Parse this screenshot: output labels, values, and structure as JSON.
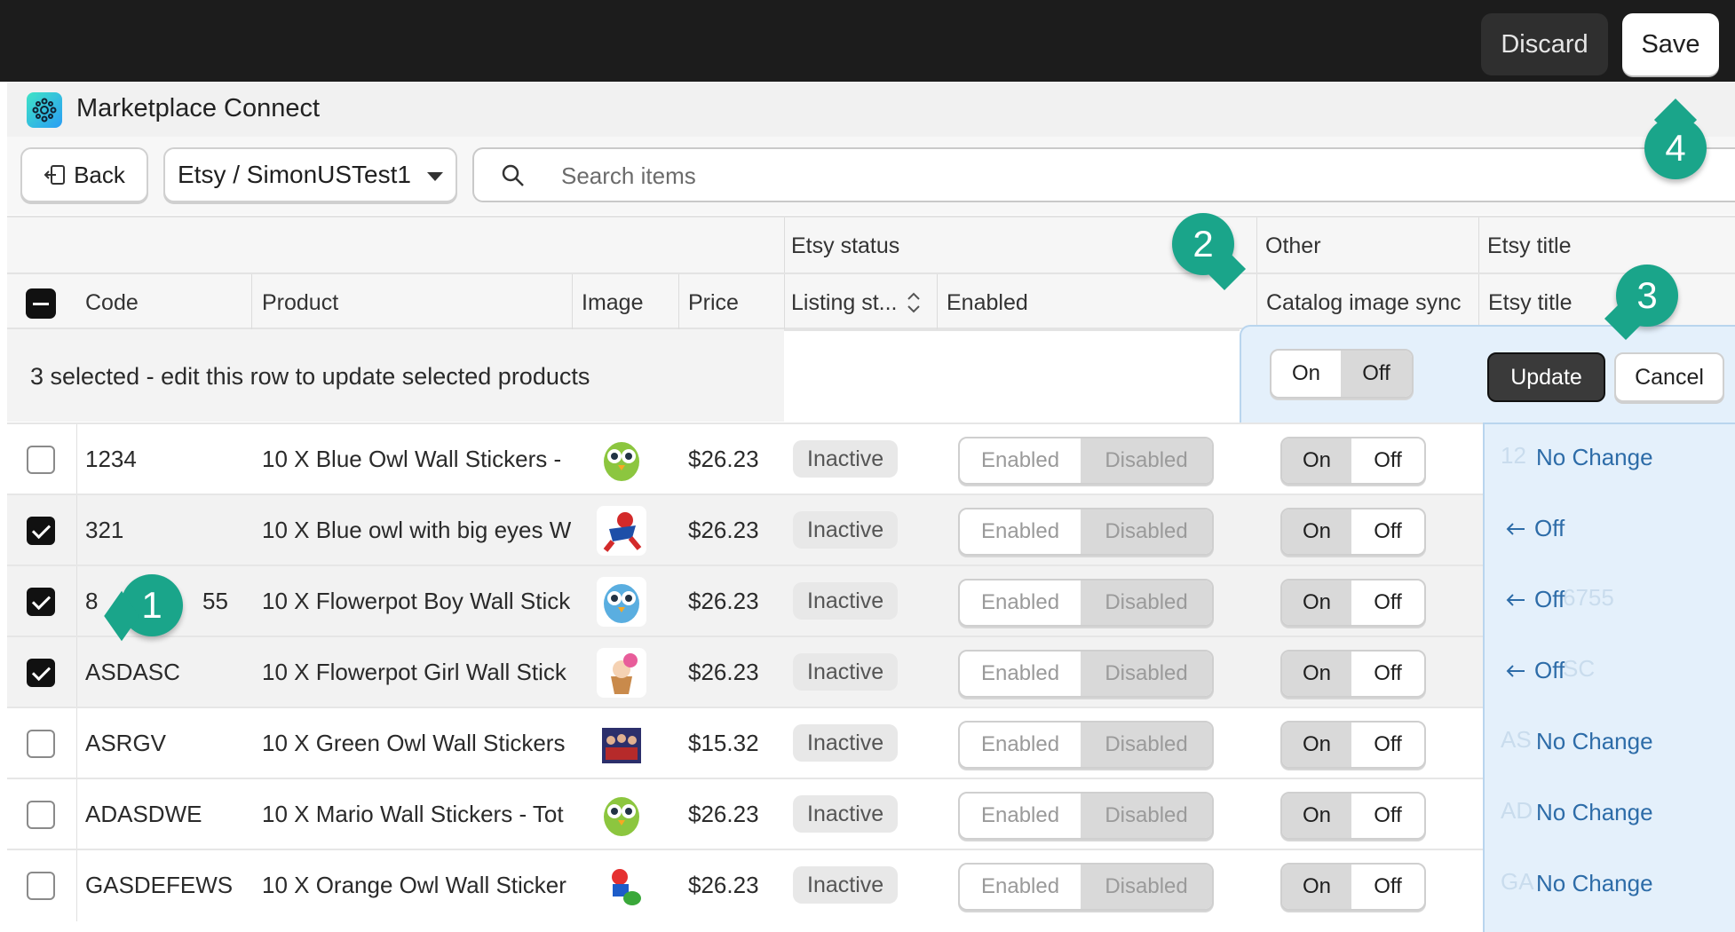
{
  "top_bar": {
    "discard_label": "Discard",
    "save_label": "Save"
  },
  "app": {
    "title": "Marketplace Connect"
  },
  "toolbar": {
    "back_label": "Back",
    "store_selector": "Etsy / SimonUSTest1",
    "search_placeholder": "Search items"
  },
  "table": {
    "groups": {
      "etsy_status": "Etsy status",
      "other": "Other",
      "etsy_title": "Etsy title"
    },
    "columns": {
      "code": "Code",
      "product": "Product",
      "image": "Image",
      "price": "Price",
      "listing_status": "Listing st...",
      "enabled": "Enabled",
      "catalog_image_sync": "Catalog image sync",
      "etsy_title": "Etsy title"
    },
    "bulk_row": {
      "message": "3 selected - edit this row to update selected products",
      "sync_on": "On",
      "sync_off": "Off",
      "sync_selected": "Off",
      "update_label": "Update",
      "cancel_label": "Cancel"
    },
    "toggle_labels": {
      "enabled": "Enabled",
      "disabled": "Disabled",
      "on": "On",
      "off": "Off"
    },
    "rows": [
      {
        "checked": false,
        "code": "1234",
        "product": "10 X Blue Owl Wall Stickers -",
        "image": "green-owl-thumbnail",
        "price": "$26.23",
        "listing_status": "Inactive",
        "enabled": "Disabled",
        "catalog_sync": "On",
        "etsy_title": "No Change",
        "etsy_title_ghost": "12"
      },
      {
        "checked": true,
        "code": "321",
        "product": "10 X Blue owl with big eyes W",
        "image": "spiderman-thumbnail",
        "price": "$26.23",
        "listing_status": "Inactive",
        "enabled": "Disabled",
        "catalog_sync": "On",
        "etsy_title": "Off",
        "etsy_title_ghost": ""
      },
      {
        "checked": true,
        "code": "8",
        "code_tail": "55",
        "product": "10 X Flowerpot Boy Wall Stick",
        "image": "blue-owl-thumbnail",
        "price": "$26.23",
        "listing_status": "Inactive",
        "enabled": "Disabled",
        "catalog_sync": "On",
        "etsy_title": "Off",
        "etsy_title_ghost": "6755"
      },
      {
        "checked": true,
        "code": "ASDASC",
        "product": "10 X Flowerpot Girl Wall Stick",
        "image": "flowerpot-girl-thumbnail",
        "price": "$26.23",
        "listing_status": "Inactive",
        "enabled": "Disabled",
        "catalog_sync": "On",
        "etsy_title": "Off",
        "etsy_title_ghost": "SC"
      },
      {
        "checked": false,
        "code": "ASRGV",
        "product": "10 X Green Owl Wall Stickers",
        "image": "team-photo-thumbnail",
        "price": "$15.32",
        "listing_status": "Inactive",
        "enabled": "Disabled",
        "catalog_sync": "On",
        "etsy_title": "No Change",
        "etsy_title_ghost": "AS"
      },
      {
        "checked": false,
        "code": "ADASDWE",
        "product": "10 X Mario Wall Stickers - Tot",
        "image": "green-owl-thumbnail",
        "price": "$26.23",
        "listing_status": "Inactive",
        "enabled": "Disabled",
        "catalog_sync": "On",
        "etsy_title": "No Change",
        "etsy_title_ghost": "AD"
      },
      {
        "checked": false,
        "code": "GASDEFEWS",
        "product": "10 X Orange Owl Wall Sticker",
        "image": "mario-thumbnail",
        "price": "$26.23",
        "listing_status": "Inactive",
        "enabled": "Disabled",
        "catalog_sync": "On",
        "etsy_title": "No Change",
        "etsy_title_ghost": "GA"
      }
    ]
  },
  "callouts": [
    "1",
    "2",
    "3",
    "4"
  ],
  "colors": {
    "accent_teal": "#1aa58a",
    "edit_panel_blue": "#e4f0fb",
    "link_blue": "#2d6ca8",
    "topbar_dark": "#1c1c1c"
  }
}
